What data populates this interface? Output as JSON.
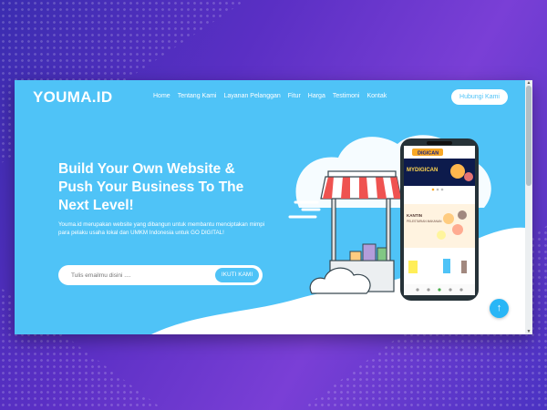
{
  "site": {
    "logo": "YOUMA.ID",
    "nav": [
      "Home",
      "Tentang Kami",
      "Layanan Pelanggan",
      "Fitur",
      "Harga",
      "Testimoni",
      "Kontak"
    ],
    "cta_button": "Hubungi Kami"
  },
  "hero": {
    "headline": "Build Your Own Website & Push Your Business To The Next Level!",
    "description": "Youma.id merupakan website yang dibangun untuk membantu menciptakan mimpi para pelaku usaha lokal dan UMKM Indonesia untuk GO DIGITAL!",
    "email_placeholder": "Tulis emailmu disini ....",
    "subscribe_button": "IKUTI KAMI"
  },
  "phone": {
    "app_badge": "DIGICAN",
    "banner_title": "MYDIGICAN",
    "card_title": "KANTIN",
    "card_subtitle": "PELESTARIAN MAKANAN"
  },
  "colors": {
    "accent": "#4fc3f7",
    "cta_dark": "#29b6f6",
    "background_purple": "#5a2fc4"
  },
  "icons": {
    "scroll_top": "arrow-up-icon"
  },
  "scroll_top_glyph": "↑"
}
